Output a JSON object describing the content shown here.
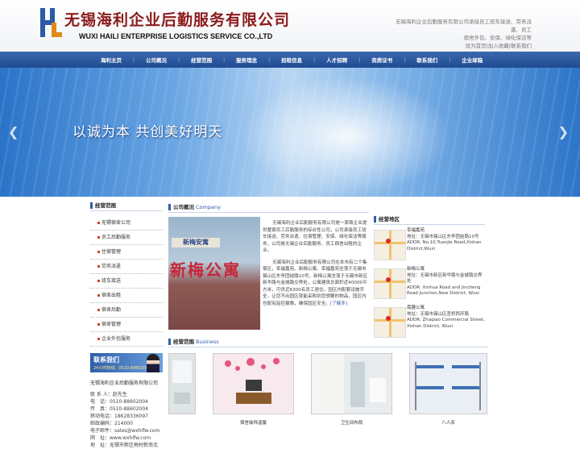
{
  "header": {
    "logo_cn": "无锡海利企业后勤服务有限公司",
    "logo_en": "WUXI HAILI ENTERPRISE LOGISTICS SERVICE CO.,LTD",
    "tagline_1": "无锡海利企业后勤服务有限公司承接员工班车接送、劳务派遣、员工",
    "tagline_2": "宿舍外包、安保、绿化保洁等",
    "links": "设为首页|加入收藏|联系我们"
  },
  "nav": {
    "items": [
      "海利主页",
      "公司概况",
      "经营范围",
      "服务理念",
      "招租信息",
      "人才招聘",
      "资质证书",
      "联系我们",
      "企业邮箱"
    ]
  },
  "banner": {
    "slogan": "以诚为本  共创美好明天",
    "prev_icon": "chevron-left-icon",
    "next_icon": "chevron-right-icon"
  },
  "left": {
    "scope_title": "经营范围",
    "menu": [
      "无锡宿舍公司",
      "员工后勤服务",
      "住宿管理",
      "劳务派遣",
      "班车接送",
      "宿舍出租",
      "宿舍后勤",
      "宿舍管理",
      "企业外包服务"
    ],
    "contact_banner_title": "联系我们",
    "contact_banner_phone": "24小时热线：0510-88602004",
    "company": "无锡海利企业后勤服务有限公司",
    "contacts": [
      "联 系 人：赵先生",
      "电　话：0510-88602004",
      "传　真：0510-88602004",
      "移动电话：18628336097",
      "邮政编码：214000",
      "电子邮件：sales@wxhlfw.com",
      "网　址：www.wxhlfw.com",
      "地　址：无锡市新区梅村新南北"
    ]
  },
  "overview": {
    "title": "公司概况",
    "title_en": "Company",
    "sign_1": "新梅安寓",
    "sign_2": "新梅公寓",
    "para_1": "无锡海利企业后勤服务有限公司是一家致企业提供整套员工后勤服务的综合性公司，公司承接员工班车接送、劳务派遣、住宿管理、安保、绿化保洁等服务，公司是无锡企业后勤服务、员工宿舍出租的企业。",
    "para_2": "无锡海利企业后勤服务有限公司在本市有二个集宿区，幸福嘉苑、新梅公寓。幸福嘉苑坐落于无锡市锡山区东亭团结路10号，新梅公寓坐落于无锡市新区新华路与金城路交界处，公寓建筑总面积近40000平方米，可供近6300名员工居住。园区内配套设施齐全，让您不出园区就能采购到您想要的物品，园区内也配有监控摄像，确保园区安全。",
    "more": "[了解多]"
  },
  "business": {
    "title": "经营范围",
    "title_en": "Business",
    "items": [
      {
        "caption": ""
      },
      {
        "caption": "宿舍装饰温馨"
      },
      {
        "caption": "卫生间布局"
      },
      {
        "caption": "八人床"
      }
    ]
  },
  "locations": {
    "title": "经营地区",
    "items": [
      {
        "name": "幸福嘉苑",
        "addr": "地址：无锡市锡山区东亭团结路10号",
        "addr_en": "ADDR: No.10,Tuanjie Road,Xishan District,Wuxi"
      },
      {
        "name": "新梅公寓",
        "addr": "地址：无锡市新区新华路与金城路交界处",
        "addr_en": "ADDR: Xinhua Road and Jincheng Road Junction,New District, Wuxi"
      },
      {
        "name": "南趣公寓",
        "addr": "地址：无锡市锡山区查桥西环路",
        "addr_en": "ADDR: Zhaqiao Commercial Street, Xishan District, Wuxi"
      }
    ]
  },
  "colors": {
    "nav": "#1f4b92",
    "accent": "#2f5ea8",
    "logo_red": "#8c1a1a"
  }
}
